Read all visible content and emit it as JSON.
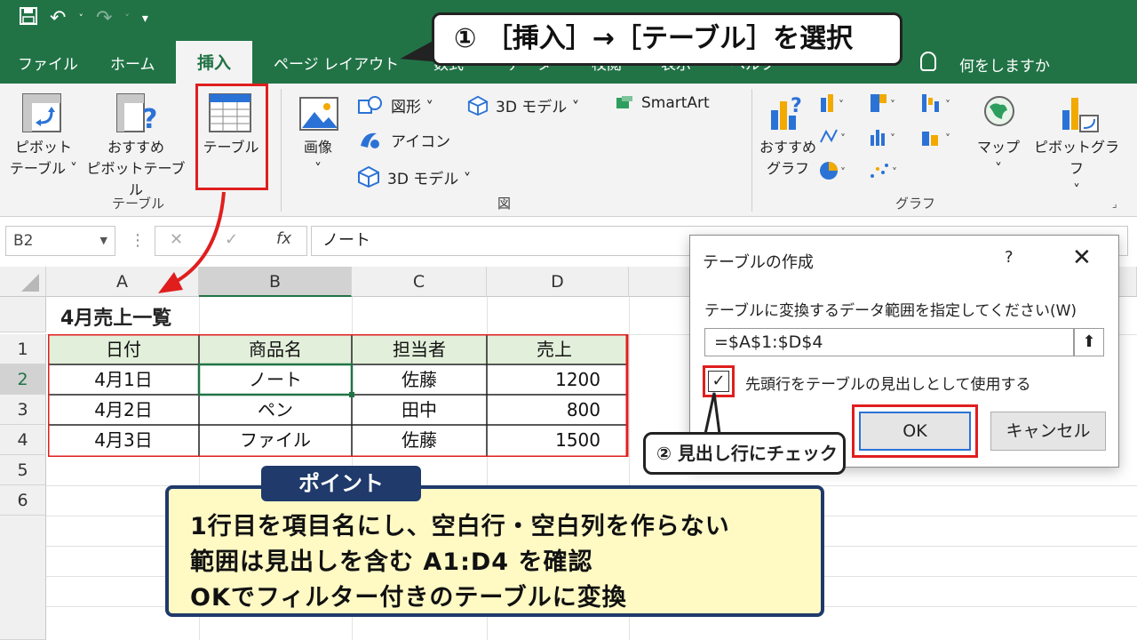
{
  "callout1": "① ［挿入］→［テーブル］を選択",
  "tabs": {
    "file": "ファイル",
    "home": "ホーム",
    "insert": "挿入",
    "page_layout": "ページ レイアウト",
    "hidden1": "数式",
    "hidden2": "データ",
    "hidden3": "校閲",
    "hidden4": "表示",
    "hidden5": "ヘルプ"
  },
  "tell_me": "何をしますか",
  "ribbon": {
    "pivot_table_1": "ピボット",
    "pivot_table_2": "テーブル ˅",
    "rec_pivot_1": "おすすめ",
    "rec_pivot_2": "ピボットテーブル",
    "table": "テーブル",
    "group_table": "テーブル",
    "image": "画像",
    "image_dd": "˅",
    "shapes": "図形 ˅",
    "icons": "アイコン",
    "model3d_a": "3D モデル ˅",
    "model3d_b": "3D モデル ˅",
    "smartart": "SmartArt",
    "group_illust": "図",
    "rec_chart_1": "おすすめ",
    "rec_chart_2": "グラフ",
    "map": "マップ",
    "map_dd": "˅",
    "pivot_chart": "ピボットグラフ",
    "pivot_chart_dd": "˅",
    "group_chart": "グラフ"
  },
  "formula_bar": {
    "name_box": "B2",
    "cancel": "✕",
    "enter": "✓",
    "fx": "fx",
    "value": "ノート"
  },
  "columns": [
    "A",
    "B",
    "C",
    "D"
  ],
  "rows": [
    "1",
    "2",
    "3",
    "4",
    "5",
    "6"
  ],
  "sheet": {
    "title": "4月売上一覧",
    "headers": [
      "日付",
      "商品名",
      "担当者",
      "売上"
    ],
    "data": [
      [
        "4月1日",
        "ノート",
        "佐藤",
        "1200"
      ],
      [
        "4月2日",
        "ペン",
        "田中",
        "800"
      ],
      [
        "4月3日",
        "ファイル",
        "佐藤",
        "1500"
      ]
    ]
  },
  "dialog": {
    "title": "テーブルの作成",
    "help": "?",
    "close": "✕",
    "prompt": "テーブルに変換するデータ範囲を指定してください(W)",
    "range": "=$A$1:$D$4",
    "range_btn": "⬆",
    "check_mark": "✓",
    "checkbox_label": "先頭行をテーブルの見出しとして使用する",
    "ok": "OK",
    "cancel": "キャンセル"
  },
  "callout2": "② 見出し行にチェック",
  "point": {
    "tag": "ポイント",
    "line1": "1行目を項目名にし、空白行・空白列を作らない",
    "line2": "範囲は見出しを含む A1:D4 を確認",
    "line3": "OKでフィルター付きのテーブルに変換"
  },
  "colors": {
    "excel_green": "#217346",
    "highlight_red": "#e01e1e",
    "point_navy": "#1f3a6b",
    "point_bg": "#fff9c4",
    "header_fill": "#e2efda"
  }
}
